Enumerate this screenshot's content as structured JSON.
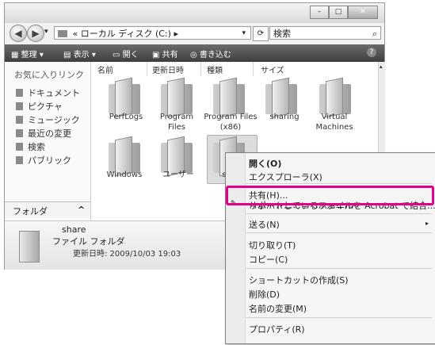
{
  "titlebar": {
    "controls": [
      "–",
      "□",
      "✕"
    ]
  },
  "address_bar": {
    "path_prefix": "«",
    "path": "ローカル ディスク (C:)",
    "path_chevron": "▸",
    "search_placeholder": "検索"
  },
  "toolbar": {
    "organize": "整理 ▾",
    "views": "表示 ▾",
    "open": "開く",
    "share": "共有",
    "burn": "書き込む",
    "help": "?"
  },
  "left_pane": {
    "title": "お気に入りリンク",
    "items": [
      "ドキュメント",
      "ピクチャ",
      "ミュージック",
      "最近の変更",
      "検索",
      "パブリック"
    ],
    "folder_label": "フォルダ",
    "folder_toggle": "^"
  },
  "columns": [
    "名前",
    "更新日時",
    "種類",
    "サイズ"
  ],
  "folders": [
    {
      "label": "PerfLogs"
    },
    {
      "label": "Program Files"
    },
    {
      "label": "Program Files (x86)"
    },
    {
      "label": "sharing"
    },
    {
      "label": "Virtual Machines"
    },
    {
      "label": "Windows"
    },
    {
      "label": "ユーザー"
    },
    {
      "label": "sh"
    }
  ],
  "details": {
    "name": "share",
    "type": "ファイル フォルダ",
    "modified": "更新日時: 2009/10/03 19:03"
  },
  "context_menu": {
    "items": [
      "開く(O)",
      "エクスプローラ(X)",
      "共有(H)...",
      "以前のバージョンの復元(V)",
      "サポートしているファイルを Acrobat で結合...",
      "送る(N)",
      "切り取り(T)",
      "コピー(C)",
      "ショートカットの作成(S)",
      "削除(D)",
      "名前の変更(M)",
      "プロパティ(R)"
    ],
    "submenu_arrow": "▸"
  },
  "highlight_color": "#e4008c"
}
